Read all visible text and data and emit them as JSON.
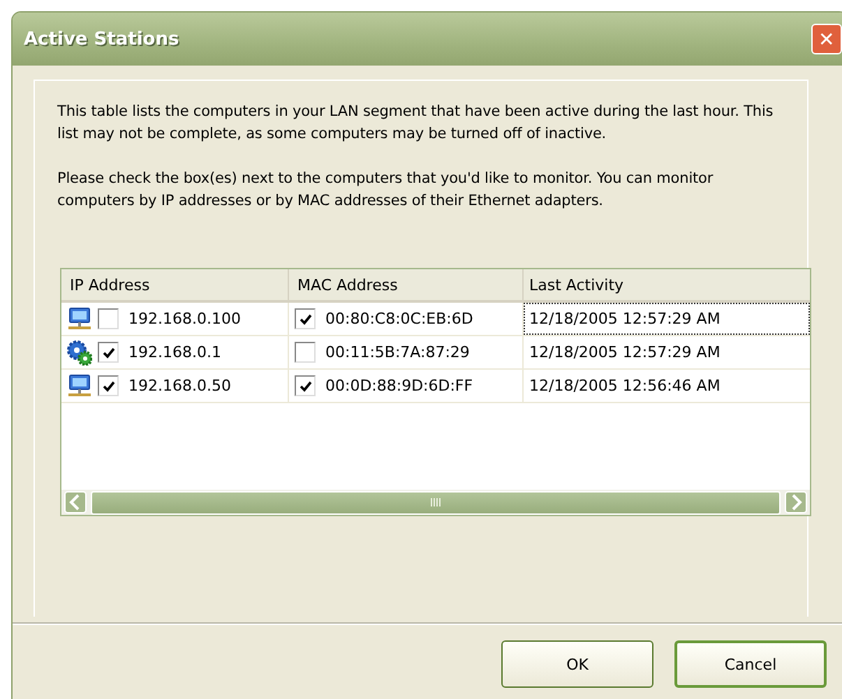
{
  "window": {
    "title": "Active Stations",
    "close": "✕"
  },
  "paragraphs": [
    "This table lists the computers in your LAN segment that have been active during the last hour. This list may not be complete, as some computers may be turned off of inactive.",
    "Please check the box(es) next to the computers that you'd like to monitor. You can monitor computers by IP addresses or by MAC addresses of their Ethernet adapters."
  ],
  "table": {
    "columns": [
      "IP Address",
      "MAC Address",
      "Last Activity"
    ],
    "rows": [
      {
        "kind": "computer",
        "ip": "192.168.0.100",
        "ip_checked": false,
        "mac": "00:80:C8:0C:EB:6D",
        "mac_checked": true,
        "last": "12/18/2005 12:57:29 AM",
        "focused": true
      },
      {
        "kind": "gear",
        "ip": "192.168.0.1",
        "ip_checked": true,
        "mac": "00:11:5B:7A:87:29",
        "mac_checked": false,
        "last": "12/18/2005 12:57:29 AM",
        "focused": false
      },
      {
        "kind": "computer",
        "ip": "192.168.0.50",
        "ip_checked": true,
        "mac": "00:0D:88:9D:6D:FF",
        "mac_checked": true,
        "last": "12/18/2005 12:56:46 AM",
        "focused": false
      }
    ]
  },
  "buttons": [
    {
      "label": "OK",
      "default": false
    },
    {
      "label": "Cancel",
      "default": true
    }
  ]
}
